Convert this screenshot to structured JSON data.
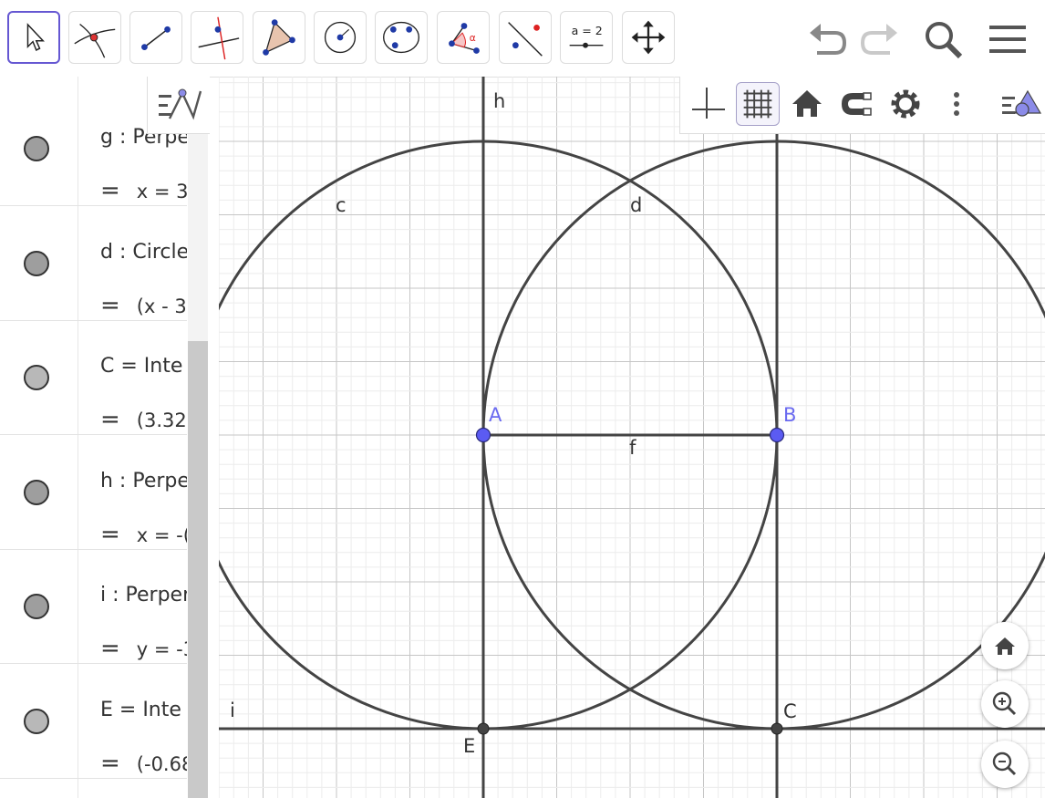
{
  "toolbar": {
    "tools": [
      "move-tool",
      "point-tool",
      "line-tool",
      "perpendicular-line-tool",
      "polygon-tool",
      "circle-tool",
      "conic-tool",
      "angle-tool",
      "reflect-tool",
      "slider-tool",
      "move-graphics-tool"
    ],
    "slider_label": "a = 2",
    "angle_label": "α"
  },
  "algebra": {
    "rows": [
      {
        "def": "g : Perpe",
        "value": "x = 3",
        "dot_color": "#9e9e9e"
      },
      {
        "def": "d : Circle",
        "value": "(x - 3",
        "dot_color": "#9e9e9e"
      },
      {
        "def": "C = Inte",
        "value": "(3.32,",
        "dot_color": "#b8b8b8"
      },
      {
        "def": "h : Perpe",
        "value": "x = -(",
        "dot_color": "#9e9e9e"
      },
      {
        "def": "i : Perper",
        "value": "y = -3",
        "dot_color": "#9e9e9e"
      },
      {
        "def": "E = Inte",
        "value": "(-0.68",
        "dot_color": "#b8b8b8"
      }
    ],
    "eq_sign": "="
  },
  "graphics": {
    "labels": {
      "h": "h",
      "c": "c",
      "d": "d",
      "A": "A",
      "B": "B",
      "f": "f",
      "i": "i",
      "C": "C",
      "E": "E"
    },
    "colors": {
      "point": "#5b5bf2",
      "curve": "#444444",
      "point_label": "#6a6af0"
    }
  }
}
